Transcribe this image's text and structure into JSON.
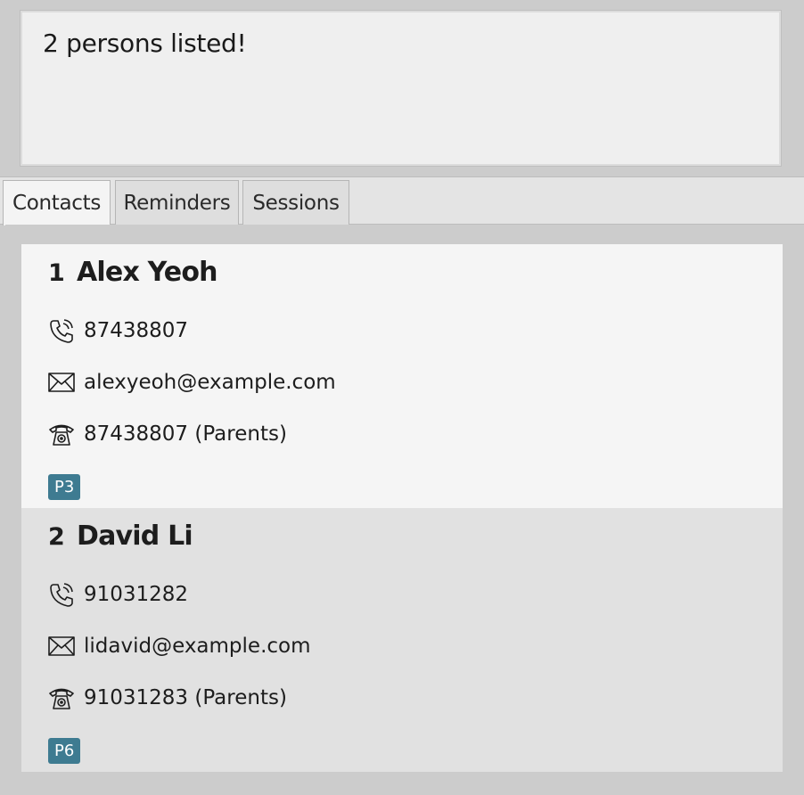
{
  "result_display": {
    "text": "2 persons listed!"
  },
  "tabs": [
    {
      "label": "Contacts",
      "active": true
    },
    {
      "label": "Reminders",
      "active": false
    },
    {
      "label": "Sessions",
      "active": false
    }
  ],
  "persons": [
    {
      "index": "1",
      "name": "Alex Yeoh",
      "phone": "87438807",
      "email": "alexyeoh@example.com",
      "parent_phone": "87438807 (Parents)",
      "tag": "P3"
    },
    {
      "index": "2",
      "name": "David Li",
      "phone": "91031282",
      "email": "lidavid@example.com",
      "parent_phone": "91031283 (Parents)",
      "tag": "P6"
    }
  ],
  "icons": {
    "phone": "mobile-phone-icon",
    "email": "envelope-icon",
    "parent_phone": "telephone-icon"
  },
  "colors": {
    "tag_background": "#3e7b91",
    "card_odd": "#f5f5f5",
    "card_even": "#e1e1e1"
  }
}
